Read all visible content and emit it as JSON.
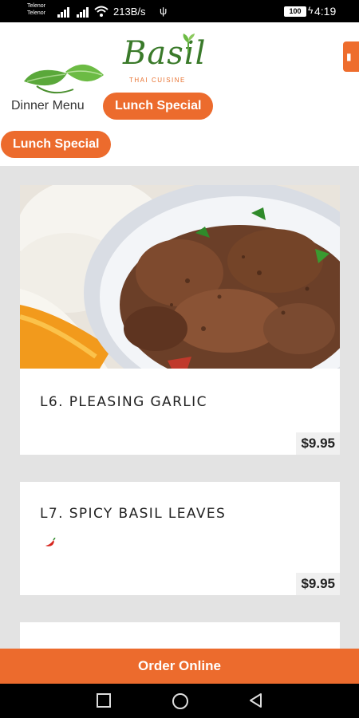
{
  "status_bar": {
    "carrier_1": "Telenor",
    "carrier_2": "Telenor",
    "network_speed": "213B/s",
    "battery_level": "100",
    "time": "4:19"
  },
  "header": {
    "logo_text": "Basil",
    "logo_subtitle": "THAI CUISINE"
  },
  "nav": {
    "dinner_menu": "Dinner Menu",
    "lunch_special": "Lunch Special",
    "lunch_special_selected": "Lunch Special"
  },
  "menu_items": [
    {
      "name": "L6. PLEASING GARLIC",
      "price": "$9.95"
    },
    {
      "name": "L7. SPICY BASIL LEAVES",
      "price": "$9.95"
    }
  ],
  "order_button": "Order Online",
  "colors": {
    "accent": "#ec6b2d",
    "logo_green": "#3a7a2a"
  }
}
